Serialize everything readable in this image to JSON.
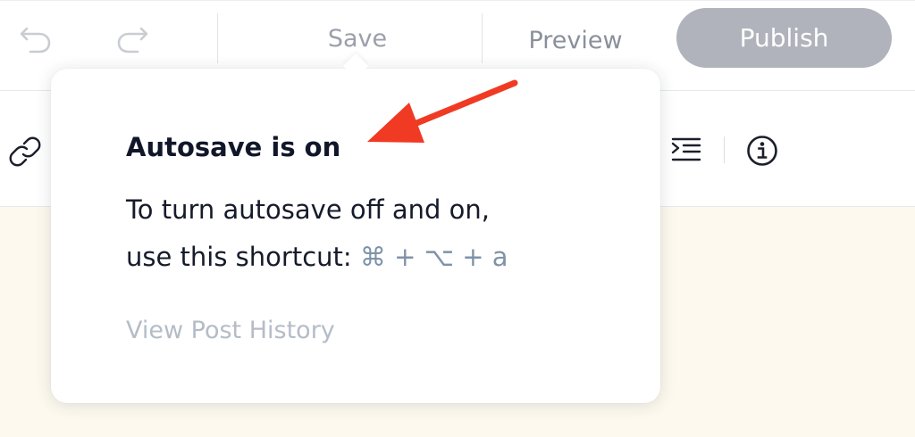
{
  "toolbar": {
    "undo_icon": "undo-icon",
    "redo_icon": "redo-icon",
    "save_label": "Save",
    "preview_label": "Preview",
    "publish_label": "Publish",
    "publish_color": "#b0b3bb"
  },
  "format_toolbar": {
    "icons": [
      "link-icon",
      "indent-icon",
      "info-icon"
    ]
  },
  "popover": {
    "title": "Autosave is on",
    "line1": "To turn autosave off and on,",
    "line2_prefix": "use this shortcut:",
    "shortcut": "⌘ + ⌥ + a",
    "history_link": "View Post History"
  },
  "annotation": {
    "icon": "arrow-annotation",
    "color": "#f03a24"
  },
  "colors": {
    "editor_background": "#fdf9ee",
    "shortcut_text": "#7f93a8"
  }
}
